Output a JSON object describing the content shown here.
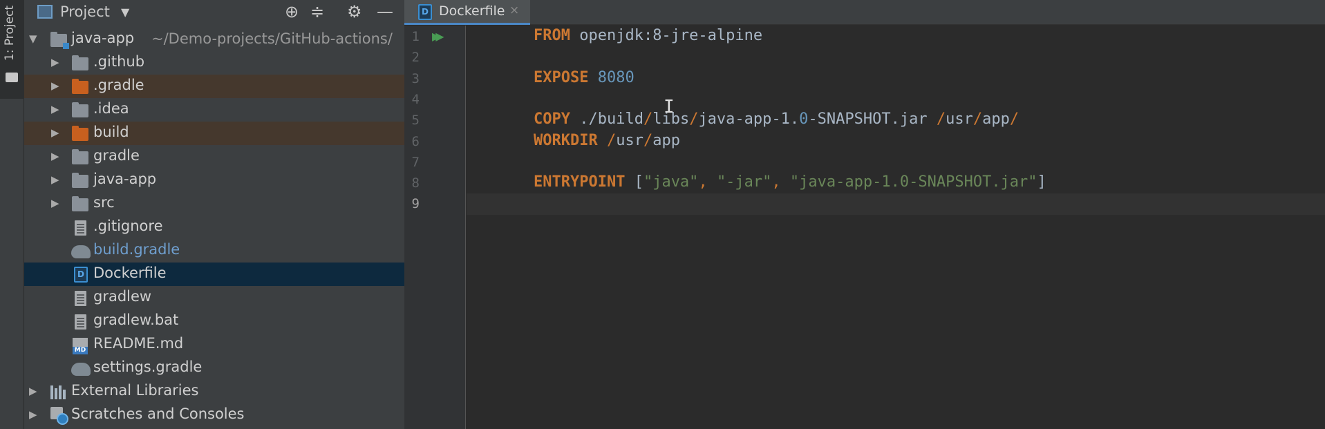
{
  "toolstrip": {
    "project_tab_label": "1: Project"
  },
  "project_panel": {
    "title": "Project",
    "tree": {
      "root": {
        "name": "java-app",
        "path": "~/Demo-projects/GitHub-actions/"
      },
      "items": [
        {
          "label": ".github"
        },
        {
          "label": ".gradle"
        },
        {
          "label": ".idea"
        },
        {
          "label": "build"
        },
        {
          "label": "gradle"
        },
        {
          "label": "java-app"
        },
        {
          "label": "src"
        },
        {
          "label": ".gitignore"
        },
        {
          "label": "build.gradle"
        },
        {
          "label": "Dockerfile"
        },
        {
          "label": "gradlew"
        },
        {
          "label": "gradlew.bat"
        },
        {
          "label": "README.md"
        },
        {
          "label": "settings.gradle"
        }
      ],
      "external_libraries": "External Libraries",
      "scratches": "Scratches and Consoles"
    }
  },
  "editor": {
    "tab": {
      "label": "Dockerfile",
      "close": "×"
    },
    "line_numbers": [
      "1",
      "2",
      "3",
      "4",
      "5",
      "6",
      "7",
      "8",
      "9"
    ],
    "run_glyph": "▶▶",
    "code": {
      "l1_kw": "FROM",
      "l1_rest": " openjdk:8-jre-alpine",
      "l3_kw": "EXPOSE",
      "l3_num": "8080",
      "l5_kw": "COPY",
      "l5_a": " ./build",
      "l5_s1": "/",
      "l5_b": "libs",
      "l5_s2": "/",
      "l5_c": "java-app-1.",
      "l5_n": "0",
      "l5_d": "-SNAPSHOT.jar ",
      "l5_s3": "/",
      "l5_e": "usr",
      "l5_s4": "/",
      "l5_f": "app",
      "l5_s5": "/",
      "l6_kw": "WORKDIR",
      "l6_a": " ",
      "l6_s1": "/",
      "l6_b": "usr",
      "l6_s2": "/",
      "l6_c": "app",
      "l8_kw": "ENTRYPOINT",
      "l8_open": " [",
      "l8_q1": "\"java\"",
      "l8_c1": ", ",
      "l8_q2": "\"-jar\"",
      "l8_c2": ", ",
      "l8_q3": "\"java-app-1.0-SNAPSHOT.jar\"",
      "l8_close": "]"
    },
    "text_cursor": "I"
  }
}
